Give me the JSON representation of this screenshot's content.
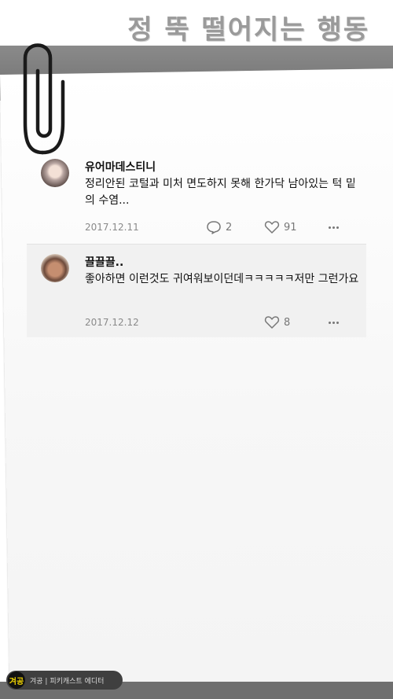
{
  "header": {
    "title": "정 뚝 떨어지는 행동"
  },
  "comments": [
    {
      "author": "유어마데스티니",
      "text": "정리안된 코털과 미처 면도하지 못해 한가닥 남아있는 턱 밑의 수염...",
      "date": "2017.12.11",
      "replies": "2",
      "likes": "91"
    },
    {
      "author": "끌끌끌..",
      "text": "좋아하면 이런것도 귀여워보이던데ㅋㅋㅋㅋㅋ저만 그런가요",
      "date": "2017.12.12",
      "likes": "8"
    }
  ],
  "footer": {
    "logo": "겨공",
    "text": "겨공 | 피키캐스트 에디터"
  }
}
